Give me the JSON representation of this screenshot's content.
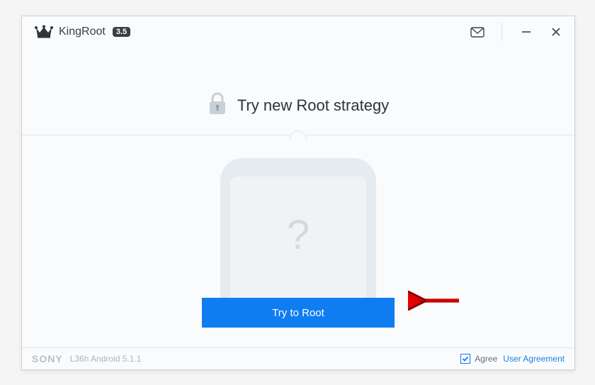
{
  "titlebar": {
    "app_name": "KingRoot",
    "version": "3.5"
  },
  "heading": {
    "text": "Try new Root strategy"
  },
  "main": {
    "placeholder_glyph": "?",
    "root_button": "Try to Root"
  },
  "footer": {
    "brand": "SONY",
    "device": "L36h Android 5.1.1",
    "agree_checked": true,
    "agree_label": "Agree",
    "ua_link": "User Agreement"
  }
}
